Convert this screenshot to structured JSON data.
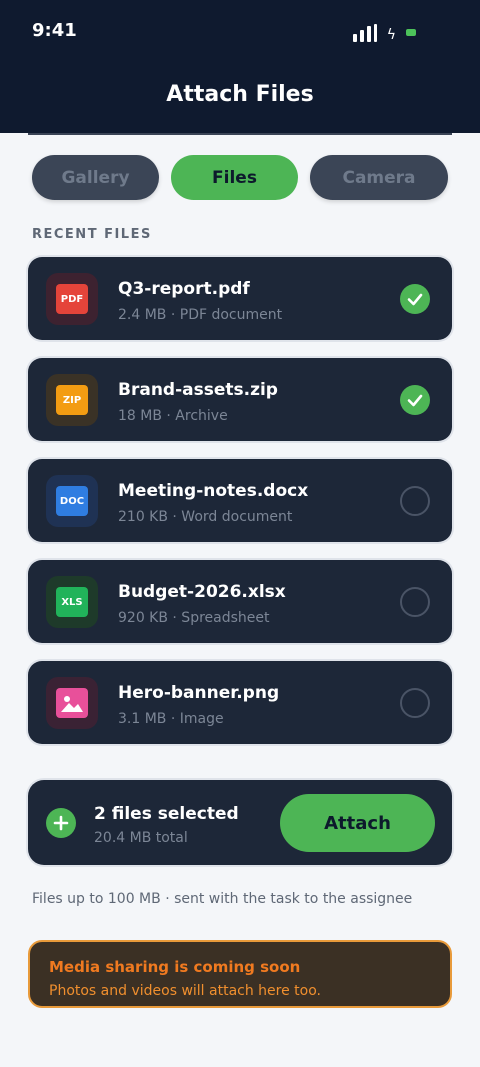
{
  "status_bar": {
    "time": "9:41"
  },
  "header": {
    "title": "Attach Files"
  },
  "tabs": [
    {
      "label": "Gallery",
      "active": false
    },
    {
      "label": "Files",
      "active": true
    },
    {
      "label": "Camera",
      "active": false
    }
  ],
  "section_label": "RECENT FILES",
  "files": [
    {
      "type_label": "PDF",
      "name": "Q3-report.pdf",
      "meta": "2.4 MB · PDF document",
      "selected": true,
      "color": "#e5443a",
      "tile": "#3d2230"
    },
    {
      "type_label": "ZIP",
      "name": "Brand-assets.zip",
      "meta": "18 MB · Archive",
      "selected": true,
      "color": "#f39c12",
      "tile": "#3a3226"
    },
    {
      "type_label": "DOC",
      "name": "Meeting-notes.docx",
      "meta": "210 KB · Word document",
      "selected": false,
      "color": "#2f7de1",
      "tile": "#1f3254"
    },
    {
      "type_label": "XLS",
      "name": "Budget-2026.xlsx",
      "meta": "920 KB · Spreadsheet",
      "selected": false,
      "color": "#21b35a",
      "tile": "#1e3a2a"
    },
    {
      "type_label": "",
      "name": "Hero-banner.png",
      "meta": "3.1 MB · Image",
      "selected": false,
      "color": "#e8509a",
      "tile": "#3a2234"
    }
  ],
  "summary": {
    "title": "2 files selected",
    "subtitle": "20.4 MB total",
    "attach_label": "Attach"
  },
  "limit_note": "Files up to 100 MB · sent with the task to the assignee",
  "notice": {
    "title": "Media sharing is coming soon",
    "text": "Photos and videos will attach here too."
  },
  "colors": {
    "accent": "#4db555",
    "header": "#0f1a2f",
    "card": "#1d2738",
    "warning": "#f07a20"
  }
}
